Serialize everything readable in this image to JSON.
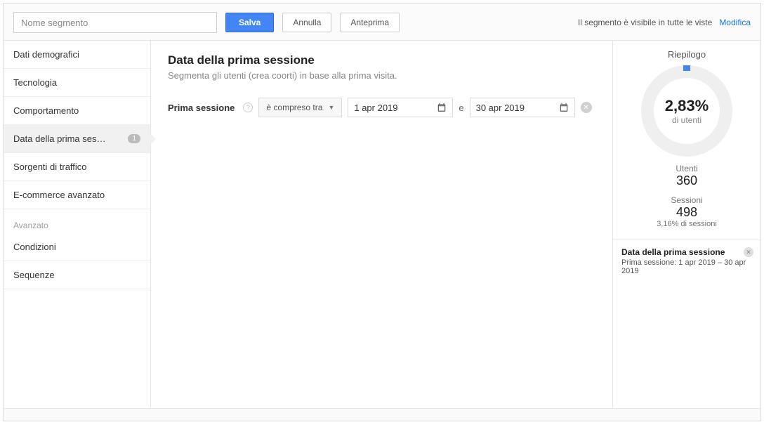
{
  "topbar": {
    "segment_name_placeholder": "Nome segmento",
    "save": "Salva",
    "cancel": "Annulla",
    "preview": "Anteprima",
    "visibility_text": "Il segmento è visibile in tutte le viste",
    "modify": "Modifica"
  },
  "sidebar": {
    "items": [
      {
        "label": "Dati demografici",
        "active": false
      },
      {
        "label": "Tecnologia",
        "active": false
      },
      {
        "label": "Comportamento",
        "active": false
      },
      {
        "label": "Data della prima ses…",
        "active": true,
        "badge": "1"
      },
      {
        "label": "Sorgenti di traffico",
        "active": false
      },
      {
        "label": "E-commerce avanzato",
        "active": false
      }
    ],
    "advanced_label": "Avanzato",
    "advanced_items": [
      {
        "label": "Condizioni"
      },
      {
        "label": "Sequenze"
      }
    ]
  },
  "main": {
    "title": "Data della prima sessione",
    "subtitle": "Segmenta gli utenti (crea coorti) in base alla prima visita.",
    "filter_label": "Prima sessione",
    "operator": "è compreso tra",
    "date_from": "1 apr 2019",
    "date_sep": "e",
    "date_to": "30 apr 2019"
  },
  "summary": {
    "title": "Riepilogo",
    "pct": "2,83%",
    "pct_sub": "di utenti",
    "users_label": "Utenti",
    "users_value": "360",
    "sessions_label": "Sessioni",
    "sessions_value": "498",
    "sessions_note": "3,16% di sessioni",
    "filter_title": "Data della prima sessione",
    "filter_text": "Prima sessione: 1 apr 2019 – 30 apr 2019"
  }
}
